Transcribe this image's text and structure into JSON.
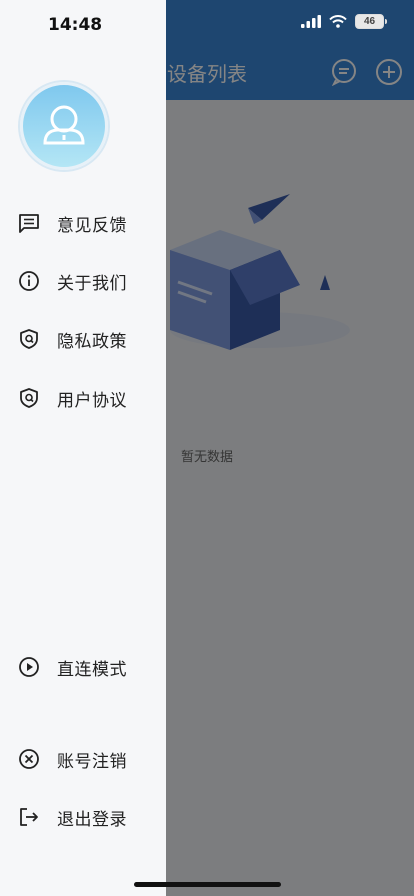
{
  "status_bar": {
    "time": "14:48",
    "battery": "46"
  },
  "app": {
    "title": "设备列表",
    "empty_text": "暂无数据"
  },
  "drawer": {
    "menu": [
      {
        "label": "意见反馈",
        "icon": "feedback-icon"
      },
      {
        "label": "关于我们",
        "icon": "info-icon"
      },
      {
        "label": "隐私政策",
        "icon": "shield-icon"
      },
      {
        "label": "用户协议",
        "icon": "shield-icon"
      }
    ],
    "bottom_menu": [
      {
        "label": "直连模式",
        "icon": "play-circle-icon"
      },
      {
        "label": "账号注销",
        "icon": "close-circle-icon"
      },
      {
        "label": "退出登录",
        "icon": "logout-icon"
      }
    ]
  },
  "colors": {
    "header": "#3a86d6",
    "drawer_bg": "#f6f7f9",
    "avatar": "#8fd3f0"
  }
}
